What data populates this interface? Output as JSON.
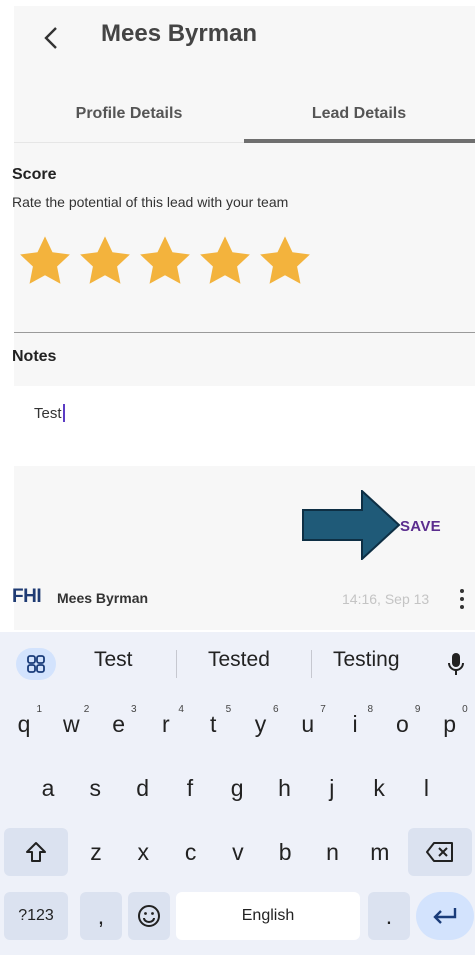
{
  "header": {
    "title": "Mees Byrman"
  },
  "tabs": [
    {
      "label": "Profile Details",
      "active": false
    },
    {
      "label": "Lead Details",
      "active": true
    }
  ],
  "score": {
    "title": "Score",
    "description": "Rate the potential of this lead with your team",
    "rating": 5,
    "max": 5,
    "star_color": "#f3b33d"
  },
  "notes": {
    "title": "Notes",
    "value": "Test"
  },
  "save_label": "SAVE",
  "message": {
    "logo": "FHI",
    "author": "Mees Byrman",
    "time": "14:16, Sep 13"
  },
  "keyboard": {
    "suggestions": [
      "Test",
      "Tested",
      "Testing"
    ],
    "row1": [
      {
        "k": "q",
        "n": "1"
      },
      {
        "k": "w",
        "n": "2"
      },
      {
        "k": "e",
        "n": "3"
      },
      {
        "k": "r",
        "n": "4"
      },
      {
        "k": "t",
        "n": "5"
      },
      {
        "k": "y",
        "n": "6"
      },
      {
        "k": "u",
        "n": "7"
      },
      {
        "k": "i",
        "n": "8"
      },
      {
        "k": "o",
        "n": "9"
      },
      {
        "k": "p",
        "n": "0"
      }
    ],
    "row2": [
      "a",
      "s",
      "d",
      "f",
      "g",
      "h",
      "j",
      "k",
      "l"
    ],
    "row3": [
      "z",
      "x",
      "c",
      "v",
      "b",
      "n",
      "m"
    ],
    "symbols_label": "?123",
    "comma": ",",
    "space_label": "English",
    "period": "."
  },
  "colors": {
    "accent": "#5b2d8e",
    "arrow": "#1f5a78",
    "keyboard_bg": "#eef1f9"
  }
}
